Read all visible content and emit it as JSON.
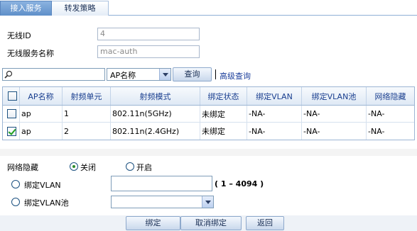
{
  "tabs": [
    "接入服务",
    "转发策略"
  ],
  "form": {
    "wireless_id_label": "无线ID",
    "wireless_id_value": "4",
    "service_name_label": "无线服务名称",
    "service_name_value": "mac-auth"
  },
  "search": {
    "value": "",
    "select_value": "AP名称",
    "query_label": "查询",
    "advanced_label": "高级查询"
  },
  "table": {
    "headers": [
      "AP名称",
      "射频单元",
      "射频模式",
      "绑定状态",
      "绑定VLAN",
      "绑定VLAN池",
      "网络隐藏"
    ],
    "rows": [
      {
        "checked": false,
        "cells": [
          "ap",
          "1",
          "802.11n(5GHz)",
          "未绑定",
          "-NA-",
          "-NA-",
          "-NA-"
        ]
      },
      {
        "checked": true,
        "cells": [
          "ap",
          "2",
          "802.11n(2.4GHz)",
          "未绑定",
          "-NA-",
          "-NA-",
          "-NA-"
        ]
      }
    ]
  },
  "settings": {
    "hide_label": "网络隐藏",
    "off_label": "关闭",
    "on_label": "开启",
    "hide_selected": "off",
    "bind_vlan_label": "绑定VLAN",
    "bind_vlan_value": "",
    "vlan_range": "( 1 – 4094 )",
    "bind_vlan_pool_label": "绑定VLAN池",
    "bind_vlan_pool_value": ""
  },
  "buttons": {
    "bind": "绑定",
    "unbind": "取消绑定",
    "back": "返回"
  }
}
